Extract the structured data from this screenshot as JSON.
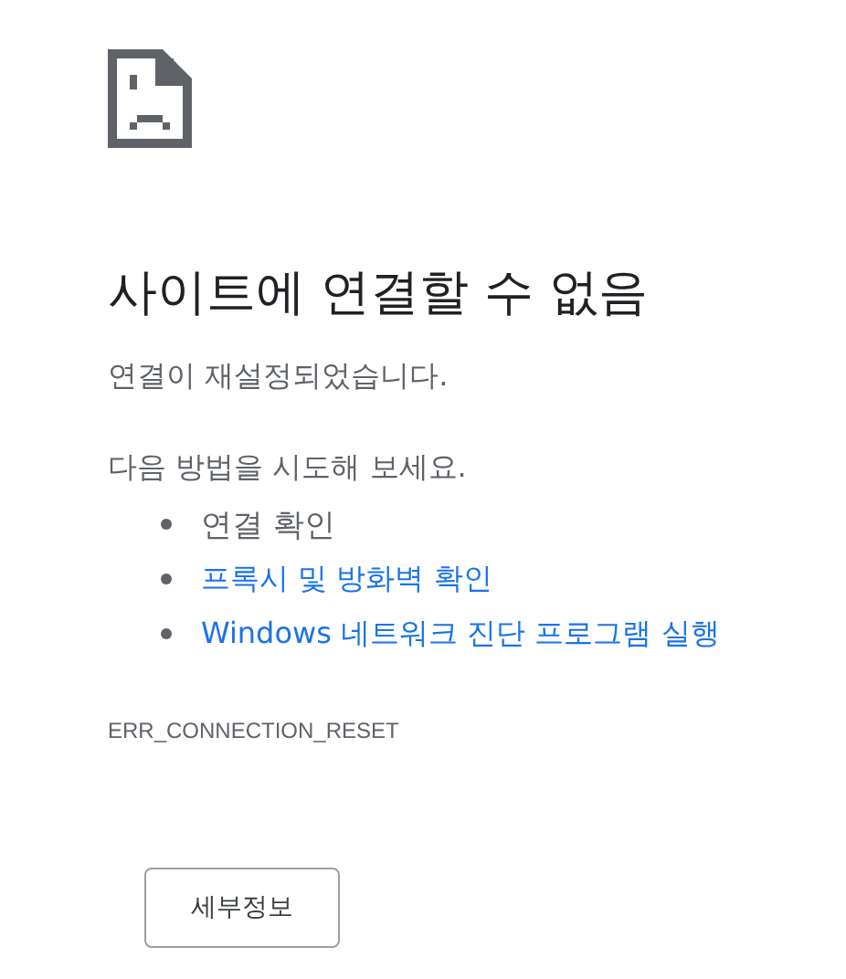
{
  "heading": "사이트에 연결할 수 없음",
  "subtitle": "연결이 재설정되었습니다.",
  "suggestions_intro": "다음 방법을 시도해 보세요.",
  "suggestions": [
    {
      "kind": "text",
      "label": "연결 확인"
    },
    {
      "kind": "link",
      "label": "프록시 및 방화벽 확인"
    },
    {
      "kind": "link",
      "label": "Windows 네트워크 진단 프로그램 실행"
    }
  ],
  "error_code": "ERR_CONNECTION_RESET",
  "details_button": "세부정보"
}
